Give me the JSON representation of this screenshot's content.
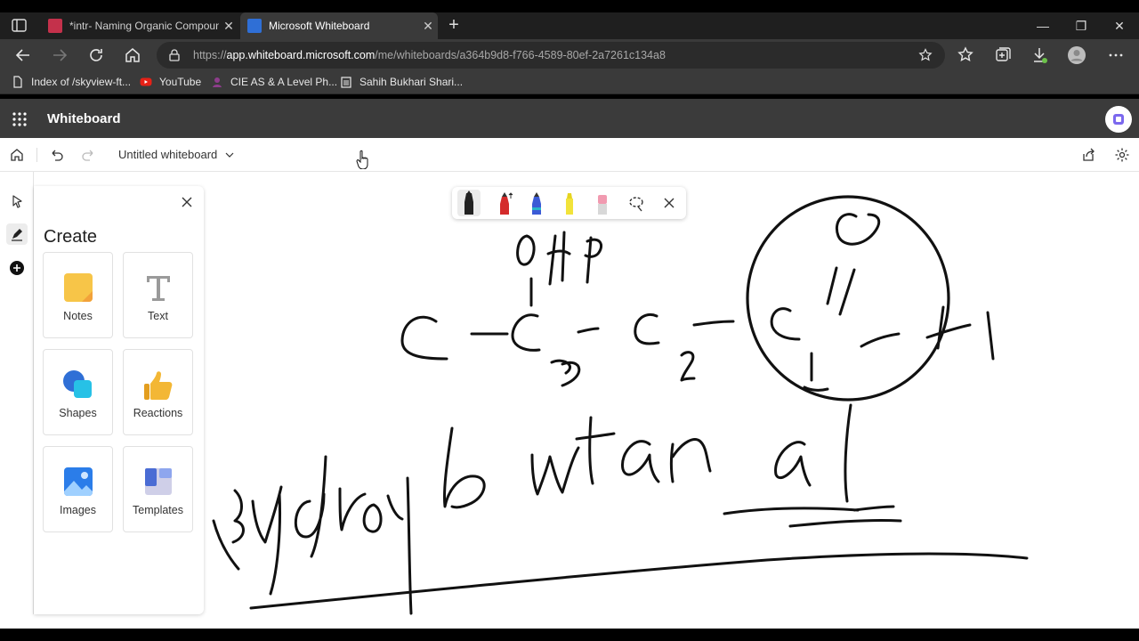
{
  "browser": {
    "tabs": [
      {
        "title": "*intr- Naming Organic Compoun",
        "icon": "pdf-icon",
        "active": false
      },
      {
        "title": "Microsoft Whiteboard",
        "icon": "whiteboard-icon",
        "active": true
      }
    ],
    "new_tab_icon": "plus-icon",
    "window_controls": [
      "minimize-icon",
      "restore-icon",
      "close-icon"
    ],
    "url_prefix": "https://",
    "url_host": "app.whiteboard.microsoft.com",
    "url_path": "/me/whiteboards/a364b9d8-f766-4589-80ef-2a7261c134a8",
    "bookmarks": [
      {
        "label": "Index of /skyview-ft...",
        "icon": "file-icon"
      },
      {
        "label": "YouTube",
        "icon": "youtube-icon"
      },
      {
        "label": "CIE AS & A Level Ph...",
        "icon": "bookmark-site-icon"
      },
      {
        "label": "Sahih Bukhari Shari...",
        "icon": "building-icon"
      }
    ]
  },
  "app": {
    "title": "Whiteboard",
    "whiteboard_name": "Untitled whiteboard"
  },
  "create_panel": {
    "title": "Create",
    "items": [
      {
        "label": "Notes",
        "icon": "notes-icon"
      },
      {
        "label": "Text",
        "icon": "text-icon"
      },
      {
        "label": "Shapes",
        "icon": "shapes-icon"
      },
      {
        "label": "Reactions",
        "icon": "thumbs-up-icon"
      },
      {
        "label": "Images",
        "icon": "image-icon"
      },
      {
        "label": "Templates",
        "icon": "templates-icon"
      }
    ]
  },
  "ink_toolbar": {
    "tools": [
      "black-pen",
      "red-pen",
      "blue-pen",
      "yellow-highlighter",
      "eraser",
      "lasso-select"
    ],
    "selected": "black-pen"
  },
  "colors": {
    "accent": "#0078d4",
    "chrome_dark": "#1f1f1f",
    "chrome_mid": "#3a3a3a",
    "ink": "#111111"
  }
}
